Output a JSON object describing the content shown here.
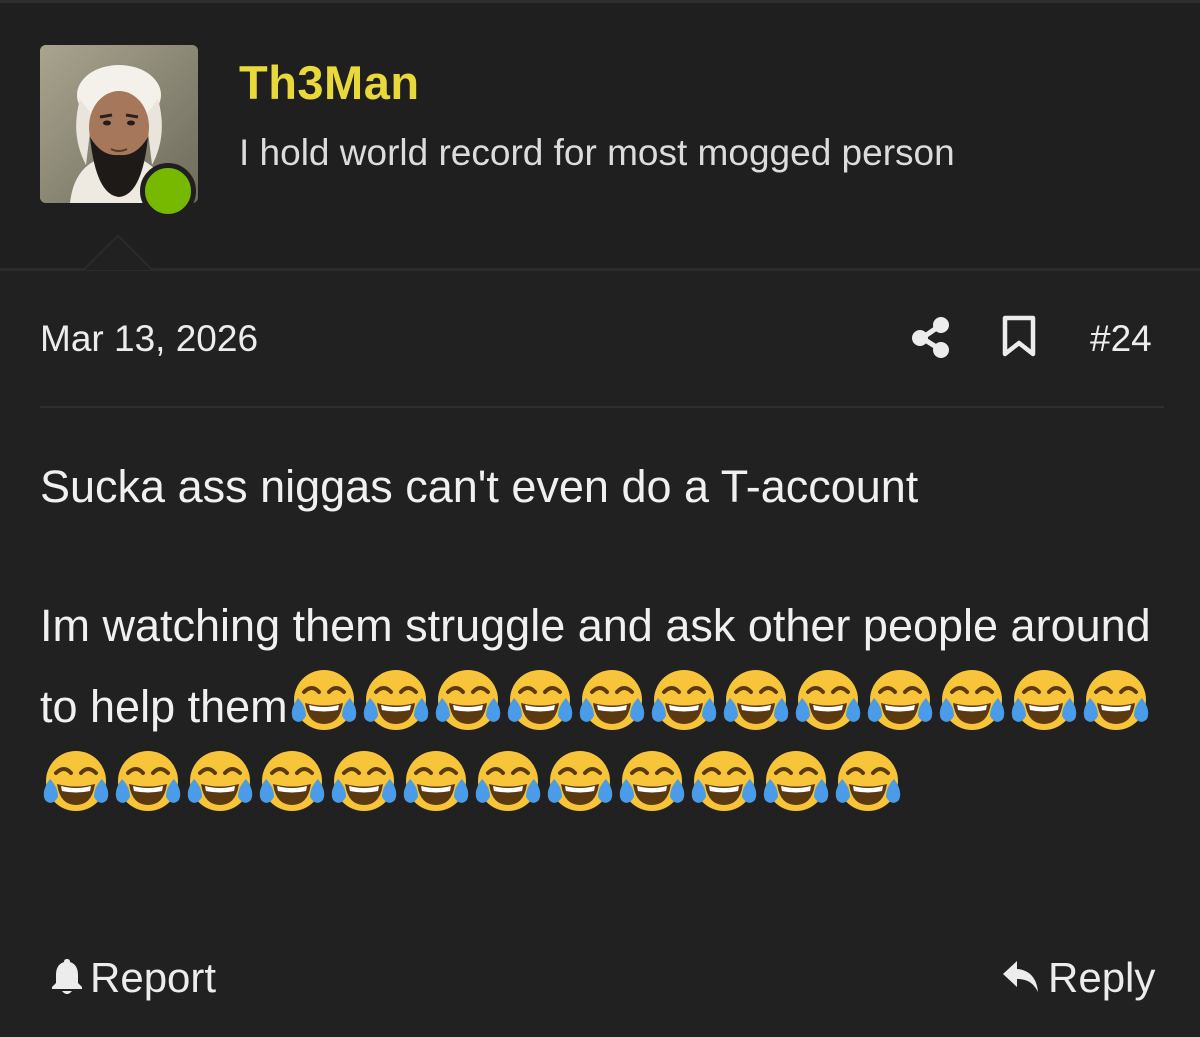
{
  "user": {
    "name": "Th3Man",
    "title": "I hold world record for most mogged person",
    "avatar_icon": "user-avatar-photo",
    "status": "online",
    "status_color": "#77b800",
    "name_color": "#e8d83a"
  },
  "post": {
    "date": "Mar 13, 2026",
    "number": "#24",
    "paragraph1": "Sucka ass niggas can't even do a T-account",
    "paragraph2": "Im watching them struggle and ask other people around to help them",
    "emoji_name": "face-with-tears-of-joy",
    "emoji_count": 24
  },
  "actions": {
    "share_icon": "share-icon",
    "bookmark_icon": "bookmark-icon",
    "report_label": "Report",
    "report_icon": "bell-icon",
    "reply_label": "Reply",
    "reply_icon": "reply-arrow-icon"
  }
}
